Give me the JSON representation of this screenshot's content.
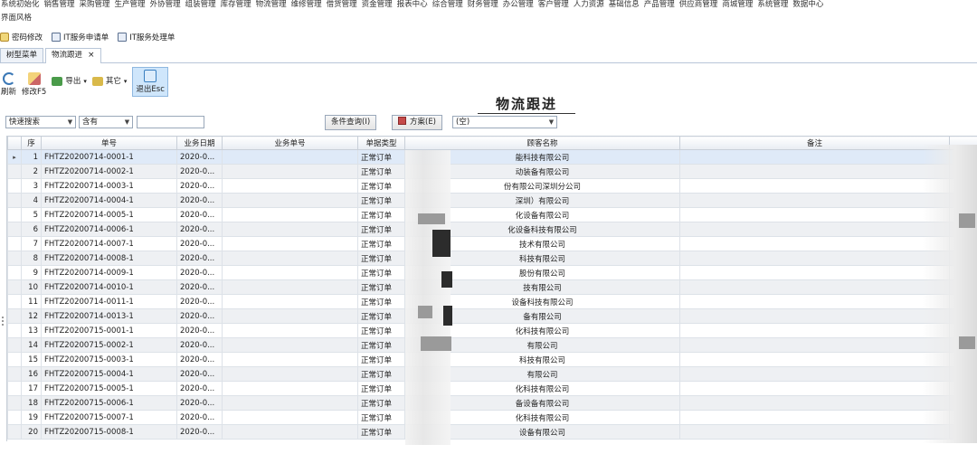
{
  "menubar": [
    "系统初始化",
    "销售管理",
    "采购管理",
    "生产管理",
    "外协管理",
    "组装管理",
    "库存管理",
    "物流管理",
    "维修管理",
    "借货管理",
    "资金管理",
    "报表中心",
    "综合管理",
    "财务管理",
    "办公管理",
    "客户管理",
    "人力资源",
    "基础信息",
    "产品管理",
    "供应商管理",
    "商城管理",
    "系统管理",
    "数据中心"
  ],
  "subbar_label": "界面风格",
  "quickbar": [
    {
      "label": "密码修改",
      "icon": "lock-icon"
    },
    {
      "label": "IT服务申请单",
      "icon": "form-icon"
    },
    {
      "label": "IT服务处理单",
      "icon": "form-icon"
    }
  ],
  "tabs": [
    {
      "label": "树型菜单",
      "active": false
    },
    {
      "label": "物流跟进",
      "active": true,
      "close": "×"
    }
  ],
  "toolbar": {
    "refresh": "刷新",
    "edit": "修改F5",
    "export": "导出",
    "other": "其它",
    "exit": "退出Esc"
  },
  "page_title": "物流跟进",
  "filter": {
    "quick_search": "快速搜索",
    "scope": "含有",
    "search_value": "",
    "condition_button": "条件查询(I)",
    "plan_button": "方案(E)",
    "plan_select": "(空)"
  },
  "table": {
    "columns": [
      "序",
      "单号",
      "业务日期",
      "业务单号",
      "单据类型",
      "顾客名称",
      "备注"
    ],
    "rows": [
      {
        "no": "1",
        "doc": "FHTZ20200714-0001-1",
        "date": "2020-0...",
        "biz": "",
        "type": "正常订单",
        "cust": "能科技有限公司",
        "note": ""
      },
      {
        "no": "2",
        "doc": "FHTZ20200714-0002-1",
        "date": "2020-0...",
        "biz": "",
        "type": "正常订单",
        "cust": "动装备有限公司",
        "note": ""
      },
      {
        "no": "3",
        "doc": "FHTZ20200714-0003-1",
        "date": "2020-0...",
        "biz": "",
        "type": "正常订单",
        "cust": "份有限公司深圳分公司",
        "note": ""
      },
      {
        "no": "4",
        "doc": "FHTZ20200714-0004-1",
        "date": "2020-0...",
        "biz": "",
        "type": "正常订单",
        "cust": "深圳）有限公司",
        "note": ""
      },
      {
        "no": "5",
        "doc": "FHTZ20200714-0005-1",
        "date": "2020-0...",
        "biz": "",
        "type": "正常订单",
        "cust": "化设备有限公司",
        "note": ""
      },
      {
        "no": "6",
        "doc": "FHTZ20200714-0006-1",
        "date": "2020-0...",
        "biz": "",
        "type": "正常订单",
        "cust": "化设备科技有限公司",
        "note": ""
      },
      {
        "no": "7",
        "doc": "FHTZ20200714-0007-1",
        "date": "2020-0...",
        "biz": "",
        "type": "正常订单",
        "cust": "技术有限公司",
        "note": ""
      },
      {
        "no": "8",
        "doc": "FHTZ20200714-0008-1",
        "date": "2020-0...",
        "biz": "",
        "type": "正常订单",
        "cust": "科技有限公司",
        "note": ""
      },
      {
        "no": "9",
        "doc": "FHTZ20200714-0009-1",
        "date": "2020-0...",
        "biz": "",
        "type": "正常订单",
        "cust": "股份有限公司",
        "note": ""
      },
      {
        "no": "10",
        "doc": "FHTZ20200714-0010-1",
        "date": "2020-0...",
        "biz": "",
        "type": "正常订单",
        "cust": "技有限公司",
        "note": ""
      },
      {
        "no": "11",
        "doc": "FHTZ20200714-0011-1",
        "date": "2020-0...",
        "biz": "",
        "type": "正常订单",
        "cust": "设备科技有限公司",
        "note": ""
      },
      {
        "no": "12",
        "doc": "FHTZ20200714-0013-1",
        "date": "2020-0...",
        "biz": "",
        "type": "正常订单",
        "cust": "备有限公司",
        "note": ""
      },
      {
        "no": "13",
        "doc": "FHTZ20200715-0001-1",
        "date": "2020-0...",
        "biz": "",
        "type": "正常订单",
        "cust": "化科技有限公司",
        "note": ""
      },
      {
        "no": "14",
        "doc": "FHTZ20200715-0002-1",
        "date": "2020-0...",
        "biz": "",
        "type": "正常订单",
        "cust": "有限公司",
        "note": ""
      },
      {
        "no": "15",
        "doc": "FHTZ20200715-0003-1",
        "date": "2020-0...",
        "biz": "",
        "type": "正常订单",
        "cust": "科技有限公司",
        "note": ""
      },
      {
        "no": "16",
        "doc": "FHTZ20200715-0004-1",
        "date": "2020-0...",
        "biz": "",
        "type": "正常订单",
        "cust": "有限公司",
        "note": ""
      },
      {
        "no": "17",
        "doc": "FHTZ20200715-0005-1",
        "date": "2020-0...",
        "biz": "",
        "type": "正常订单",
        "cust": "化科技有限公司",
        "note": ""
      },
      {
        "no": "18",
        "doc": "FHTZ20200715-0006-1",
        "date": "2020-0...",
        "biz": "",
        "type": "正常订单",
        "cust": "备设备有限公司",
        "note": ""
      },
      {
        "no": "19",
        "doc": "FHTZ20200715-0007-1",
        "date": "2020-0...",
        "biz": "",
        "type": "正常订单",
        "cust": "化科技有限公司",
        "note": ""
      },
      {
        "no": "20",
        "doc": "FHTZ20200715-0008-1",
        "date": "2020-0...",
        "biz": "",
        "type": "正常订单",
        "cust": "设备有限公司",
        "note": ""
      }
    ]
  }
}
